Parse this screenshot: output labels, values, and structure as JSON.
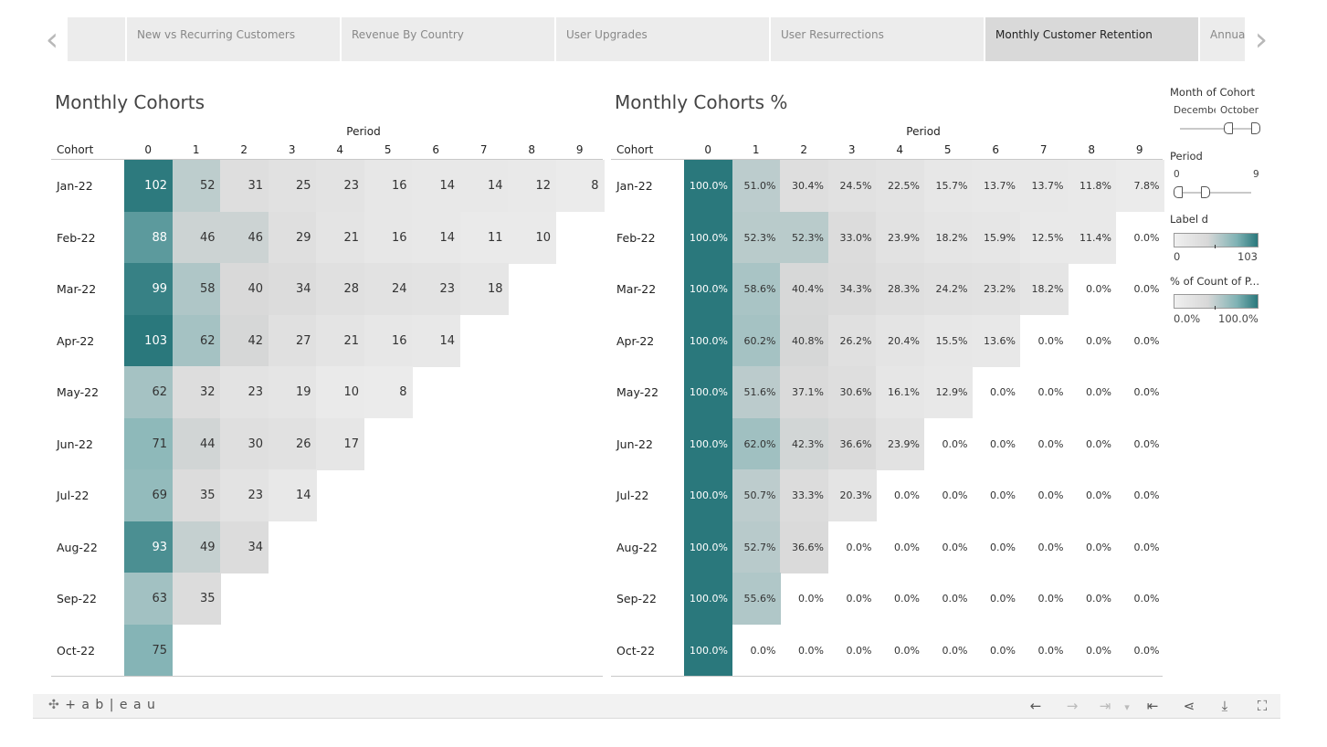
{
  "nav": {
    "prev_icon": "chevron-left-icon",
    "next_icon": "chevron-right-icon",
    "prev_glyph": "‹",
    "next_glyph": "›"
  },
  "tabs": [
    {
      "label": ""
    },
    {
      "label": "New vs Recurring Customers"
    },
    {
      "label": "Revenue By Country"
    },
    {
      "label": "User Upgrades"
    },
    {
      "label": "User Resurrections"
    },
    {
      "label": "Monthly Customer Retention",
      "active": true
    },
    {
      "label": "Annual"
    }
  ],
  "left": {
    "title": "Monthly Cohorts",
    "period_label": "Period",
    "cohort_label": "Cohort"
  },
  "right": {
    "title": "Monthly Cohorts %",
    "period_label": "Period",
    "cohort_label": "Cohort"
  },
  "chart_data": [
    {
      "type": "heatmap",
      "title": "Monthly Cohorts",
      "xlabel": "Period",
      "ylabel": "Cohort",
      "columns": [
        "0",
        "1",
        "2",
        "3",
        "4",
        "5",
        "6",
        "7",
        "8",
        "9"
      ],
      "rows": [
        "Jan-22",
        "Feb-22",
        "Mar-22",
        "Apr-22",
        "May-22",
        "Jun-22",
        "Jul-22",
        "Aug-22",
        "Sep-22",
        "Oct-22"
      ],
      "values": [
        [
          102,
          52,
          31,
          25,
          23,
          16,
          14,
          14,
          12,
          8
        ],
        [
          88,
          46,
          46,
          29,
          21,
          16,
          14,
          11,
          10
        ],
        [
          99,
          58,
          40,
          34,
          28,
          24,
          23,
          18
        ],
        [
          103,
          62,
          42,
          27,
          21,
          16,
          14
        ],
        [
          62,
          32,
          23,
          19,
          10,
          8
        ],
        [
          71,
          44,
          30,
          26,
          17
        ],
        [
          69,
          35,
          23,
          14
        ],
        [
          93,
          49,
          34
        ],
        [
          63,
          35
        ],
        [
          75
        ]
      ],
      "color_range": [
        0,
        103
      ],
      "colors": [
        "#f0f0f0",
        "#2a787c"
      ]
    },
    {
      "type": "heatmap",
      "title": "Monthly Cohorts %",
      "xlabel": "Period",
      "ylabel": "Cohort",
      "columns": [
        "0",
        "1",
        "2",
        "3",
        "4",
        "5",
        "6",
        "7",
        "8",
        "9"
      ],
      "rows": [
        "Jan-22",
        "Feb-22",
        "Mar-22",
        "Apr-22",
        "May-22",
        "Jun-22",
        "Jul-22",
        "Aug-22",
        "Sep-22",
        "Oct-22"
      ],
      "values": [
        [
          "100.0%",
          "51.0%",
          "30.4%",
          "24.5%",
          "22.5%",
          "15.7%",
          "13.7%",
          "13.7%",
          "11.8%",
          "7.8%"
        ],
        [
          "100.0%",
          "52.3%",
          "52.3%",
          "33.0%",
          "23.9%",
          "18.2%",
          "15.9%",
          "12.5%",
          "11.4%",
          "0.0%"
        ],
        [
          "100.0%",
          "58.6%",
          "40.4%",
          "34.3%",
          "28.3%",
          "24.2%",
          "23.2%",
          "18.2%",
          "0.0%",
          "0.0%"
        ],
        [
          "100.0%",
          "60.2%",
          "40.8%",
          "26.2%",
          "20.4%",
          "15.5%",
          "13.6%",
          "0.0%",
          "0.0%",
          "0.0%"
        ],
        [
          "100.0%",
          "51.6%",
          "37.1%",
          "30.6%",
          "16.1%",
          "12.9%",
          "0.0%",
          "0.0%",
          "0.0%",
          "0.0%"
        ],
        [
          "100.0%",
          "62.0%",
          "42.3%",
          "36.6%",
          "23.9%",
          "0.0%",
          "0.0%",
          "0.0%",
          "0.0%",
          "0.0%"
        ],
        [
          "100.0%",
          "50.7%",
          "33.3%",
          "20.3%",
          "0.0%",
          "0.0%",
          "0.0%",
          "0.0%",
          "0.0%",
          "0.0%"
        ],
        [
          "100.0%",
          "52.7%",
          "36.6%",
          "0.0%",
          "0.0%",
          "0.0%",
          "0.0%",
          "0.0%",
          "0.0%",
          "0.0%"
        ],
        [
          "100.0%",
          "55.6%",
          "0.0%",
          "0.0%",
          "0.0%",
          "0.0%",
          "0.0%",
          "0.0%",
          "0.0%",
          "0.0%"
        ],
        [
          "100.0%",
          "0.0%",
          "0.0%",
          "0.0%",
          "0.0%",
          "0.0%",
          "0.0%",
          "0.0%",
          "0.0%",
          "0.0%"
        ]
      ],
      "color_range": [
        0,
        100
      ],
      "colors": [
        "#f0f0f0",
        "#2a787c"
      ]
    }
  ],
  "filters": {
    "month_of_cohort": {
      "label": "Month of Cohort",
      "start": "December",
      "end": "October"
    },
    "period": {
      "label": "Period",
      "min": "0",
      "max": "9"
    },
    "label_legend": {
      "label": "Label d",
      "min": "0",
      "max": "103"
    },
    "pct_legend": {
      "label": "% of Count of P...",
      "min": "0.0%",
      "max": "100.0%"
    }
  },
  "footer": {
    "logo_text": "+ a b | e a u",
    "buttons": [
      {
        "name": "undo-button",
        "icon": "undo-icon",
        "glyph": "←",
        "enabled": true
      },
      {
        "name": "redo-button",
        "icon": "redo-icon",
        "glyph": "→",
        "enabled": false
      },
      {
        "name": "revert-button",
        "icon": "revert-icon",
        "glyph": "⇥",
        "enabled": false
      },
      {
        "name": "revert-menu-button",
        "icon": "chevron-down-icon",
        "glyph": "▾",
        "enabled": false
      },
      {
        "name": "revert-all-button",
        "icon": "revert-all-icon",
        "glyph": "⇤",
        "enabled": true
      },
      {
        "name": "share-button",
        "icon": "share-icon",
        "glyph": "⋖",
        "enabled": true
      },
      {
        "name": "download-button",
        "icon": "download-icon",
        "glyph": "⤓",
        "enabled": true
      },
      {
        "name": "fullscreen-button",
        "icon": "fullscreen-icon",
        "glyph": "⛶",
        "enabled": true
      }
    ]
  }
}
